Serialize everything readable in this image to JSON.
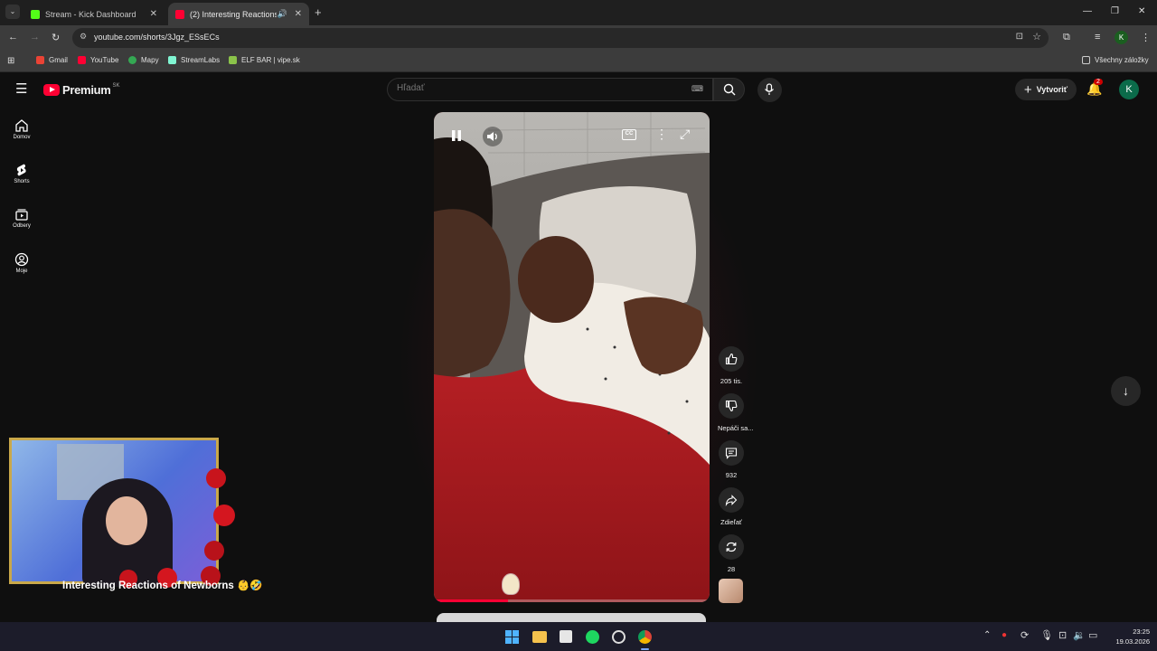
{
  "browser": {
    "tabs": [
      {
        "title": "Stream - Kick Dashboard",
        "favicon_color": "#53fc18"
      },
      {
        "title": "(2) Interesting Reactions of",
        "favicon_color": "#ff0033"
      }
    ],
    "url": "youtube.com/shorts/3Jgz_ESsECs",
    "bookmarks": [
      {
        "label": "Gmail",
        "color": "#ea4335"
      },
      {
        "label": "YouTube",
        "color": "#ff0033"
      },
      {
        "label": "Mapy",
        "color": "#34a853"
      },
      {
        "label": "StreamLabs",
        "color": "#80f5d2"
      },
      {
        "label": "ELF BAR | vipe.sk",
        "color": "#8bc34a"
      }
    ],
    "all_bookmarks": "Všechny záložky",
    "profile_initial": "K"
  },
  "youtube": {
    "logo_text": "Premium",
    "region": "SK",
    "search_placeholder": "Hľadať",
    "create_label": "Vytvoriť",
    "notifications_count": "2",
    "avatar_initial": "K",
    "nav": [
      {
        "label": "Domov",
        "icon": "home-icon"
      },
      {
        "label": "Shorts",
        "icon": "shorts-icon"
      },
      {
        "label": "Odbery",
        "icon": "subscriptions-icon"
      },
      {
        "label": "Moje",
        "icon": "you-icon"
      }
    ],
    "actions": {
      "likes": "205 tis.",
      "dislike_label": "Nepáči sa...",
      "comments": "932",
      "share_label": "Zdieľať",
      "remix_count": "28"
    },
    "short_title": "Interesting Reactions of Newborns 👶🤣",
    "progress": 0.27
  },
  "taskbar": {
    "time": "23:25",
    "date": "19.03.2026"
  },
  "colors": {
    "accent": "#ff0033",
    "kick": "#53fc18"
  }
}
